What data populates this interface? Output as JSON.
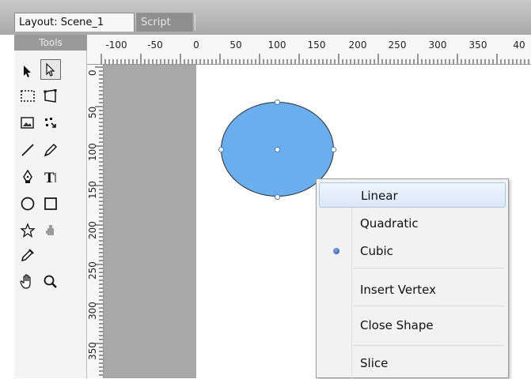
{
  "tabs": [
    {
      "label": "Layout: Scene_1",
      "active": true
    },
    {
      "label": "Script",
      "active": false
    }
  ],
  "tools": {
    "header": "Tools",
    "items": [
      {
        "name": "select-arrow-icon",
        "glyph": "➤",
        "selected": false
      },
      {
        "name": "subselect-icon",
        "glyph": "↖",
        "selected": true
      },
      {
        "name": "marquee-icon",
        "glyph": "⬚",
        "selected": false
      },
      {
        "name": "transform-icon",
        "glyph": "◺",
        "selected": false
      },
      {
        "name": "image-icon",
        "glyph": "▣",
        "selected": false
      },
      {
        "name": "scale-icon",
        "glyph": "⤡",
        "selected": false
      },
      {
        "name": "line-icon",
        "glyph": "╱",
        "selected": false
      },
      {
        "name": "pencil-icon",
        "glyph": "✎",
        "selected": false
      },
      {
        "name": "pen-icon",
        "glyph": "✒",
        "selected": false
      },
      {
        "name": "text-icon",
        "glyph": "T",
        "selected": false
      },
      {
        "name": "ellipse-icon",
        "glyph": "○",
        "selected": false
      },
      {
        "name": "rectangle-icon",
        "glyph": "□",
        "selected": false
      },
      {
        "name": "star-icon",
        "glyph": "☆",
        "selected": false
      },
      {
        "name": "paint-bucket-icon",
        "glyph": "♜",
        "selected": false
      },
      {
        "name": "eyedropper-icon",
        "glyph": "✐",
        "selected": false
      },
      {
        "name": "hand-icon",
        "glyph": "✋",
        "selected": false
      },
      {
        "name": "zoom-icon",
        "glyph": "🔍",
        "selected": false
      }
    ]
  },
  "ruler": {
    "horizontal": [
      "-100",
      "-50",
      "0",
      "50",
      "100",
      "150",
      "200",
      "250",
      "300",
      "350",
      "40"
    ],
    "vertical": [
      "0",
      "50",
      "100",
      "150",
      "200",
      "250",
      "300",
      "350"
    ]
  },
  "shape": {
    "fill": "#6aaef0"
  },
  "context_menu": {
    "items": [
      {
        "label": "Linear",
        "hover": true,
        "checked": false
      },
      {
        "label": "Quadratic",
        "hover": false,
        "checked": false
      },
      {
        "label": "Cubic",
        "hover": false,
        "checked": true
      },
      {
        "label": "Insert Vertex",
        "hover": false,
        "checked": false
      },
      {
        "label": "Close Shape",
        "hover": false,
        "checked": false
      },
      {
        "label": "Slice",
        "hover": false,
        "checked": false
      }
    ]
  }
}
